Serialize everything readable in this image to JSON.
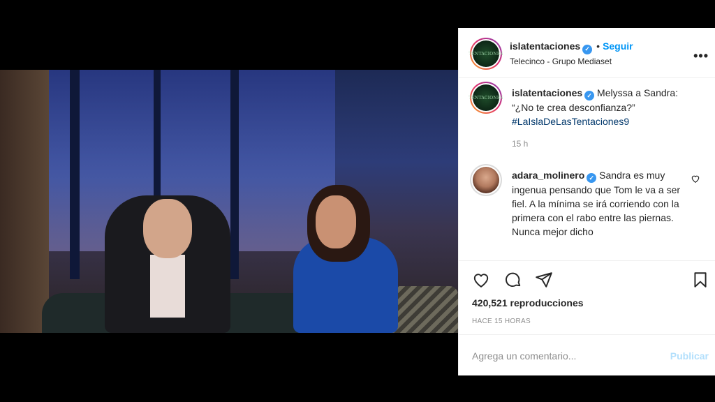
{
  "header": {
    "username": "islatentaciones",
    "follow_label": "Seguir",
    "location": "Telecinco - Grupo Mediaset",
    "avatar_text": "TENTACIONES"
  },
  "caption": {
    "username": "islatentaciones",
    "text": "Melyssa a Sandra: “¿No te crea desconfianza?”",
    "hashtag": "#LaIslaDeLasTentaciones9",
    "time": "15 h"
  },
  "comments": [
    {
      "username": "adara_molinero",
      "text": "Sandra es muy ingenua pensando que Tom le va a ser fiel. A la mínima se irá corriendo con la primera con el rabo entre las piernas. Nunca mejor dicho"
    }
  ],
  "stats": {
    "views": "420,521 reproducciones",
    "ago": "HACE 15 HORAS"
  },
  "add_comment": {
    "placeholder": "Agrega un comentario...",
    "publish_label": "Publicar"
  },
  "icons": {
    "verified": "verified-badge-icon",
    "more": "more-options-icon",
    "like": "heart-icon",
    "comment": "comment-bubble-icon",
    "share": "paper-plane-icon",
    "save": "bookmark-icon",
    "sound": "speaker-icon"
  },
  "colors": {
    "accent": "#0095f6",
    "hashtag": "#00376b",
    "muted": "#8e8e8e",
    "publish_disabled": "#b2dffc"
  }
}
